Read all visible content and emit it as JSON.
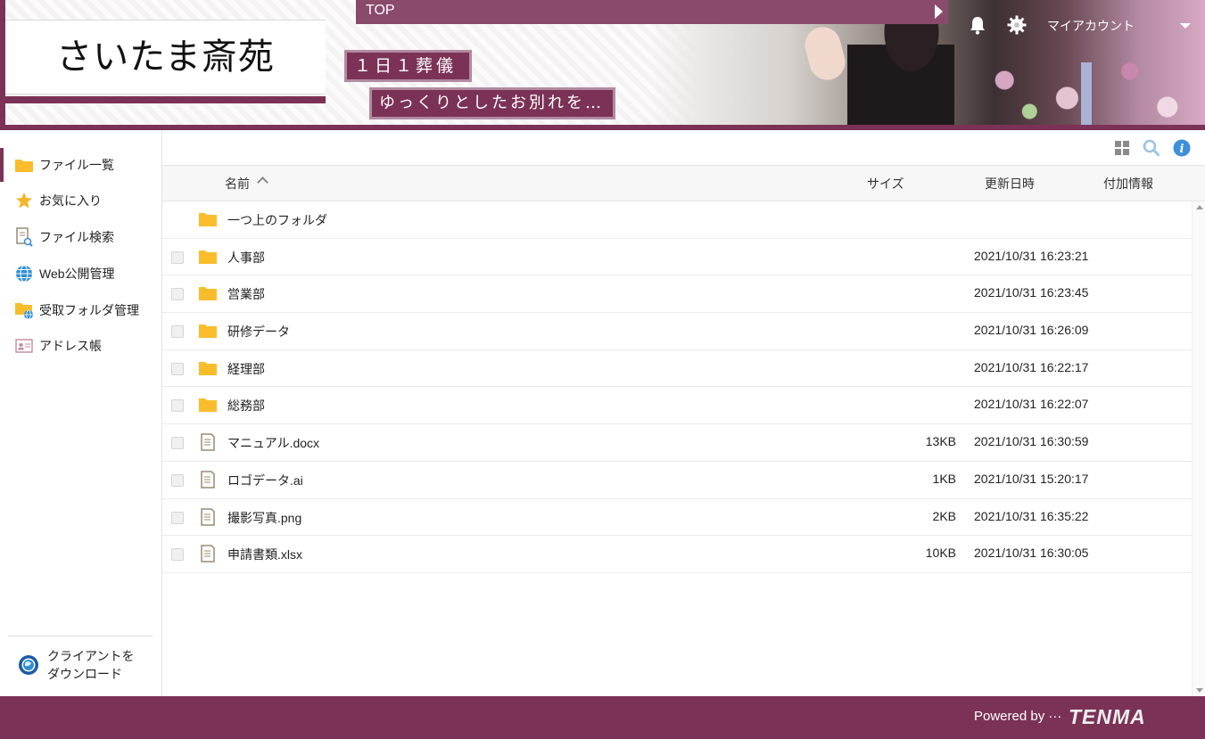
{
  "header": {
    "logo": "さいたま斎苑",
    "top_label": "TOP",
    "tagline1": "１日１葬儀",
    "tagline2": "ゆっくりとしたお別れを…",
    "account_label": "マイアカウント",
    "icons": [
      "bell-icon",
      "gear-icon",
      "caret-down-icon"
    ]
  },
  "sidebar": {
    "items": [
      {
        "label": "ファイル一覧",
        "icon": "folder-icon",
        "active": true
      },
      {
        "label": "お気に入り",
        "icon": "star-icon",
        "active": false
      },
      {
        "label": "ファイル検索",
        "icon": "file-search-icon",
        "active": false
      },
      {
        "label": "Web公開管理",
        "icon": "globe-icon",
        "active": false
      },
      {
        "label": "受取フォルダ管理",
        "icon": "folder-globe-icon",
        "active": false
      },
      {
        "label": "アドレス帳",
        "icon": "address-card-icon",
        "active": false
      }
    ],
    "client_download": {
      "line1": "クライアントを",
      "line2": "ダウンロード",
      "icon": "client-globe-icon"
    }
  },
  "toolbar": {
    "icons": [
      "grid-view-icon",
      "search-icon",
      "info-icon"
    ]
  },
  "list": {
    "headers": {
      "name": "名前",
      "size": "サイズ",
      "modified": "更新日時",
      "extra": "付加情報"
    },
    "sort": {
      "column": "name",
      "direction": "ascending"
    },
    "up_folder": "一つ上のフォルダ",
    "rows": [
      {
        "type": "folder",
        "name": "人事部",
        "size": "",
        "modified": "2021/10/31 16:23:21"
      },
      {
        "type": "folder",
        "name": "営業部",
        "size": "",
        "modified": "2021/10/31 16:23:45"
      },
      {
        "type": "folder",
        "name": "研修データ",
        "size": "",
        "modified": "2021/10/31 16:26:09"
      },
      {
        "type": "folder",
        "name": "経理部",
        "size": "",
        "modified": "2021/10/31 16:22:17"
      },
      {
        "type": "folder",
        "name": "総務部",
        "size": "",
        "modified": "2021/10/31 16:22:07"
      },
      {
        "type": "file",
        "name": "マニュアル.docx",
        "size": "13KB",
        "modified": "2021/10/31 16:30:59"
      },
      {
        "type": "file",
        "name": "ロゴデータ.ai",
        "size": "1KB",
        "modified": "2021/10/31 15:20:17"
      },
      {
        "type": "file",
        "name": "撮影写真.png",
        "size": "2KB",
        "modified": "2021/10/31 16:35:22"
      },
      {
        "type": "file",
        "name": "申請書類.xlsx",
        "size": "10KB",
        "modified": "2021/10/31 16:30:05"
      }
    ]
  },
  "footer": {
    "powered_by": "Powered by ···",
    "brand": "TENMA"
  },
  "colors": {
    "brand": "#7b3256",
    "folder": "#f9bd2c",
    "info": "#3d8fd9"
  }
}
